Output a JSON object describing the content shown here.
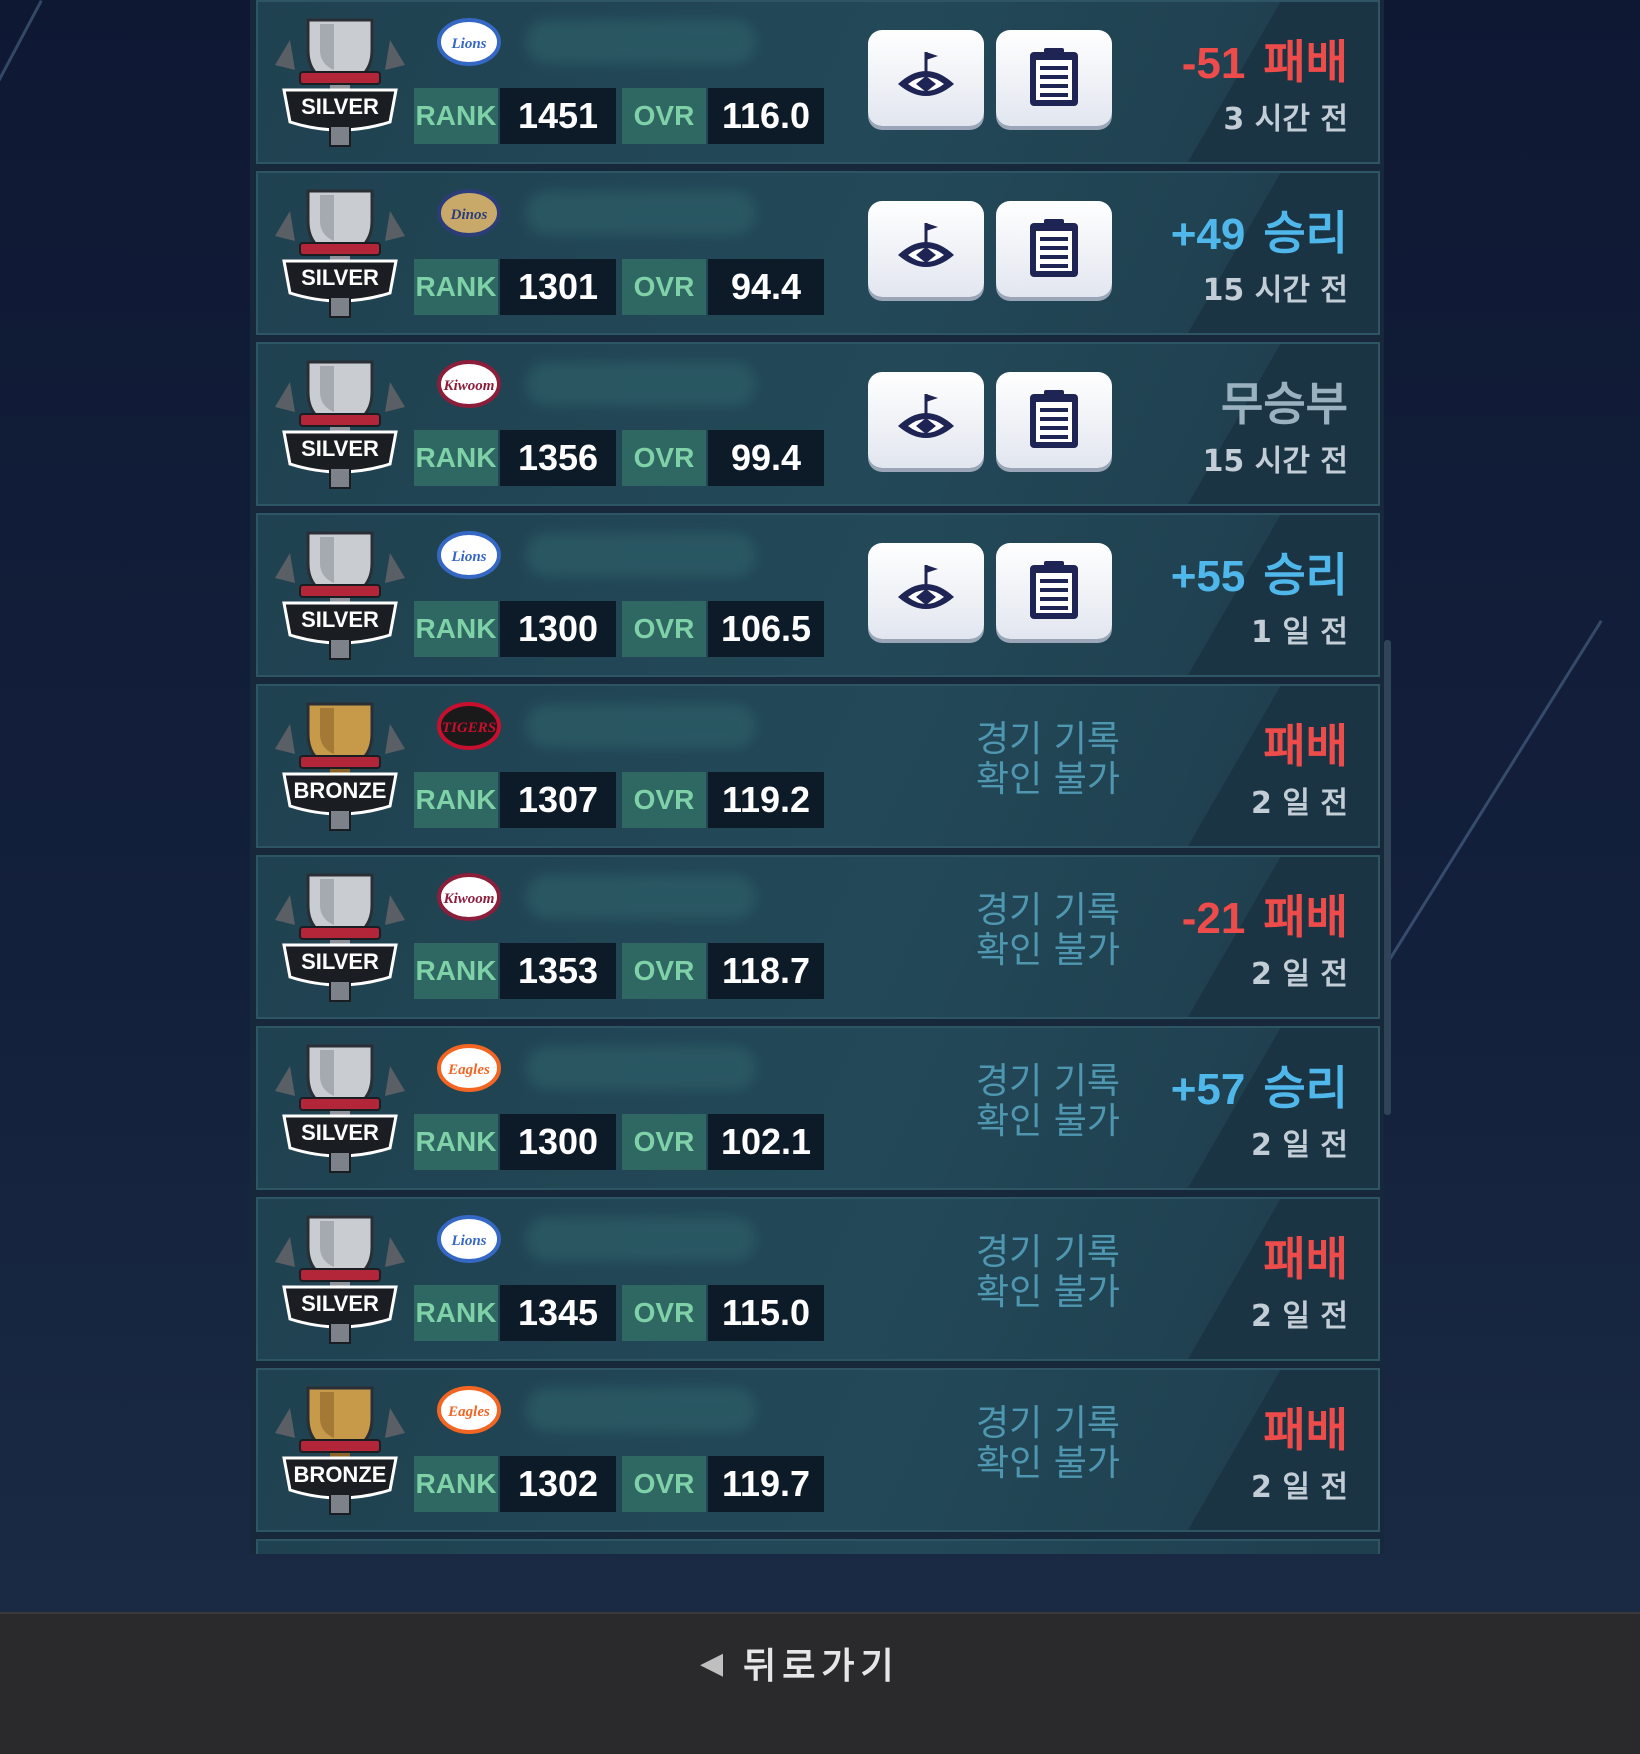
{
  "labels": {
    "rank": "RANK",
    "ovr": "OVR"
  },
  "colors": {
    "win": "#4fb7ea",
    "loss": "#ee4b4b",
    "draw": "#9ab1c0"
  },
  "matches": [
    {
      "tier": "SILVER",
      "team": "Lions",
      "rank": "1451",
      "ovr": "116.0",
      "record_available": true,
      "points": "-51",
      "result": "패배",
      "result_type": "loss",
      "time": "3 시간 전"
    },
    {
      "tier": "SILVER",
      "team": "Dinos",
      "rank": "1301",
      "ovr": "94.4",
      "record_available": true,
      "points": "+49",
      "result": "승리",
      "result_type": "win",
      "time": "15 시간 전"
    },
    {
      "tier": "SILVER",
      "team": "Kiwoom",
      "rank": "1356",
      "ovr": "99.4",
      "record_available": true,
      "points": "",
      "result": "무승부",
      "result_type": "draw",
      "time": "15 시간 전"
    },
    {
      "tier": "SILVER",
      "team": "Lions",
      "rank": "1300",
      "ovr": "106.5",
      "record_available": true,
      "points": "+55",
      "result": "승리",
      "result_type": "win",
      "time": "1 일 전"
    },
    {
      "tier": "BRONZE",
      "team": "TIGERS",
      "rank": "1307",
      "ovr": "119.2",
      "record_available": false,
      "unavailable_line1": "경기 기록",
      "unavailable_line2": "확인 불가",
      "points": "",
      "result": "패배",
      "result_type": "loss",
      "time": "2 일 전"
    },
    {
      "tier": "SILVER",
      "team": "Kiwoom",
      "rank": "1353",
      "ovr": "118.7",
      "record_available": false,
      "unavailable_line1": "경기 기록",
      "unavailable_line2": "확인 불가",
      "points": "-21",
      "result": "패배",
      "result_type": "loss",
      "time": "2 일 전"
    },
    {
      "tier": "SILVER",
      "team": "Eagles",
      "rank": "1300",
      "ovr": "102.1",
      "record_available": false,
      "unavailable_line1": "경기 기록",
      "unavailable_line2": "확인 불가",
      "points": "+57",
      "result": "승리",
      "result_type": "win",
      "time": "2 일 전"
    },
    {
      "tier": "SILVER",
      "team": "Lions",
      "rank": "1345",
      "ovr": "115.0",
      "record_available": false,
      "unavailable_line1": "경기 기록",
      "unavailable_line2": "확인 불가",
      "points": "",
      "result": "패배",
      "result_type": "loss",
      "time": "2 일 전"
    },
    {
      "tier": "BRONZE",
      "team": "Eagles",
      "rank": "1302",
      "ovr": "119.7",
      "record_available": false,
      "unavailable_line1": "경기 기록",
      "unavailable_line2": "확인 불가",
      "points": "",
      "result": "패배",
      "result_type": "loss",
      "time": "2 일 전"
    }
  ],
  "footer": {
    "back_label": "뒤로가기",
    "back_icon": "chevron-left-icon"
  }
}
